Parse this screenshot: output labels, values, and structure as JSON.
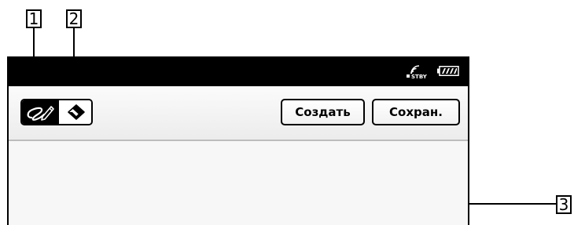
{
  "callouts": {
    "one": "1",
    "two": "2",
    "three": "3"
  },
  "status_bar": {
    "standby_label": "STBY",
    "icons": [
      "wireless-standby-icon",
      "battery-icon"
    ]
  },
  "toolbar": {
    "tools": [
      {
        "name": "pen-icon",
        "selected": true
      },
      {
        "name": "eraser-icon",
        "selected": false
      }
    ],
    "create_label": "Создать",
    "save_label": "Сохран."
  },
  "colors": {
    "status_bar": "#000000",
    "toolbar_bg": "#f4f4f4",
    "canvas_bg": "#f7f7f7"
  }
}
